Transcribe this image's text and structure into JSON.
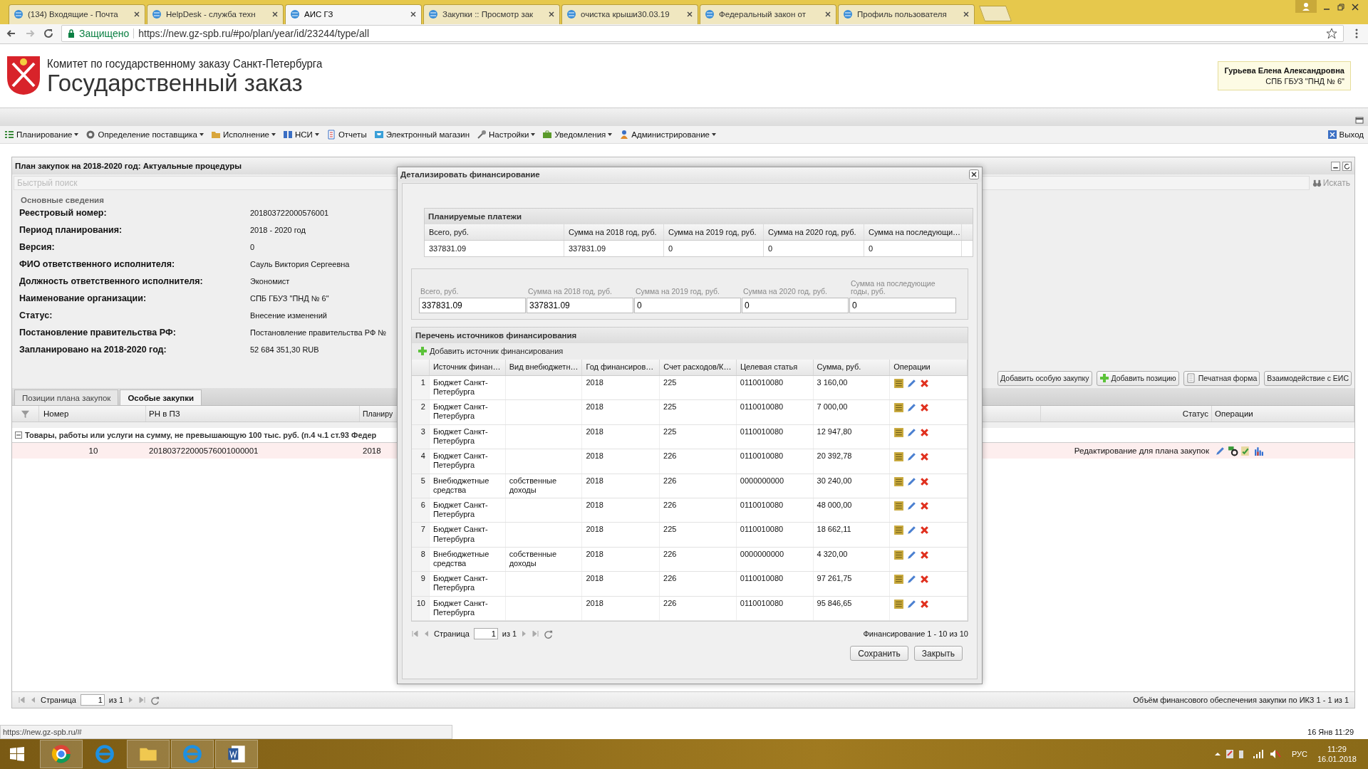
{
  "browser": {
    "tabs": [
      {
        "title": "(134) Входящие - Почта",
        "selected": false
      },
      {
        "title": "HelpDesk - служба техн",
        "selected": false
      },
      {
        "title": "АИС ГЗ",
        "selected": true
      },
      {
        "title": "Закупки :: Просмотр зак",
        "selected": false
      },
      {
        "title": "очистка крыши30.03.19",
        "selected": false
      },
      {
        "title": "Федеральный закон от",
        "selected": false
      },
      {
        "title": "Профиль пользователя",
        "selected": false
      }
    ],
    "secure_label": "Защищено",
    "url": "https://new.gz-spb.ru/#po/plan/year/id/23244/type/all"
  },
  "header": {
    "org": "Комитет по государственному заказу Санкт-Петербурга",
    "title": "Государственный заказ",
    "user_name": "Гурьева Елена Александровна",
    "user_org": "СПБ ГБУЗ \"ПНД № 6\""
  },
  "menu": [
    {
      "label": "Планирование",
      "has_dropdown": true
    },
    {
      "label": "Определение поставщика",
      "has_dropdown": true
    },
    {
      "label": "Исполнение",
      "has_dropdown": true
    },
    {
      "label": "НСИ",
      "has_dropdown": true
    },
    {
      "label": "Отчеты",
      "has_dropdown": false
    },
    {
      "label": "Электронный магазин",
      "has_dropdown": false
    },
    {
      "label": "Настройки",
      "has_dropdown": true
    },
    {
      "label": "Уведомления",
      "has_dropdown": true
    },
    {
      "label": "Администрирование",
      "has_dropdown": true
    }
  ],
  "menu_exit": "Выход",
  "panel": {
    "title": "План закупок на 2018-2020 год: Актуальные процедуры",
    "search_placeholder": "Быстрый поиск",
    "search_button": "Искать",
    "section": "Основные сведения",
    "fields": [
      {
        "label": "Реестровый номер:",
        "value": "201803722000576001"
      },
      {
        "label": "Период планирования:",
        "value": "2018 - 2020 год"
      },
      {
        "label": "Версия:",
        "value": "0"
      },
      {
        "label": "ФИО ответственного исполнителя:",
        "value": "Сауль Виктория Сергеевна"
      },
      {
        "label": "Должность ответственного исполнителя:",
        "value": "Экономист"
      },
      {
        "label": "Наименование организации:",
        "value": "СПБ ГБУЗ \"ПНД № 6\""
      },
      {
        "label": "Статус:",
        "value": "Внесение изменений"
      },
      {
        "label": "Постановление правительства РФ:",
        "value": "Постановление правительства РФ №"
      },
      {
        "label": "Запланировано на 2018-2020 год:",
        "value": "52 684 351,30 RUB"
      }
    ],
    "buttons": [
      "Добавить особую закупку",
      "Добавить позицию",
      "Печатная форма",
      "Взаимодействие с ЕИС"
    ],
    "tabs": [
      {
        "label": "Позиции плана закупок",
        "selected": false
      },
      {
        "label": "Особые закупки",
        "selected": true
      }
    ],
    "columns": [
      "Номер",
      "РН в ПЗ",
      "Планиру",
      "Статус",
      "Операции"
    ],
    "group": "Товары, работы или услуги на сумму, не превышающую 100 тыс. руб. (п.4 ч.1 ст.93 Федер",
    "rows": [
      {
        "number": "10",
        "rn": "201803722000576001000001",
        "year": "2018",
        "status": "Редактирование для плана закупок",
        "selected": true
      }
    ],
    "paging": {
      "label": "Страница",
      "page": "1",
      "of": "из 1",
      "summary": "Объём финансового обеспечения закупки по ИКЗ 1 - 1 из 1"
    }
  },
  "dialog": {
    "title": "Детализировать финансирование",
    "planned": {
      "title": "Планируемые платежи",
      "columns": [
        "Всего, руб.",
        "Сумма на 2018 год, руб.",
        "Сумма на 2019 год, руб.",
        "Сумма на 2020 год, руб.",
        "Сумма на последующи…"
      ],
      "row": [
        "337831.09",
        "337831.09",
        "0",
        "0",
        "0"
      ]
    },
    "fields": [
      {
        "label": "Всего, руб.",
        "value": "337831.09"
      },
      {
        "label": "Сумма на 2018 год, руб.",
        "value": "337831.09"
      },
      {
        "label": "Сумма на 2019 год, руб.",
        "value": "0"
      },
      {
        "label": "Сумма на 2020 год, руб.",
        "value": "0"
      },
      {
        "label": "Сумма на последующие годы, руб.",
        "value": "0"
      }
    ],
    "sources": {
      "title": "Перечень источников финансирования",
      "add_button": "Добавить источник финансирования",
      "columns": [
        "Источник финан…",
        "Вид внебюджетн…",
        "Год финансиров…",
        "Счет расходов/К…",
        "Целевая статья",
        "Сумма, руб.",
        "Операции"
      ],
      "rows": [
        {
          "n": "1",
          "source": "Бюджет Санкт-Петербурга",
          "kind": "",
          "year": "2018",
          "account": "225",
          "target": "0110010080",
          "sum": "3 160,00"
        },
        {
          "n": "2",
          "source": "Бюджет Санкт-Петербурга",
          "kind": "",
          "year": "2018",
          "account": "225",
          "target": "0110010080",
          "sum": "7 000,00"
        },
        {
          "n": "3",
          "source": "Бюджет Санкт-Петербурга",
          "kind": "",
          "year": "2018",
          "account": "225",
          "target": "0110010080",
          "sum": "12 947,80"
        },
        {
          "n": "4",
          "source": "Бюджет Санкт-Петербурга",
          "kind": "",
          "year": "2018",
          "account": "226",
          "target": "0110010080",
          "sum": "20 392,78"
        },
        {
          "n": "5",
          "source": "Внебюджетные средства",
          "kind": "собственные доходы",
          "year": "2018",
          "account": "226",
          "target": "0000000000",
          "sum": "30 240,00"
        },
        {
          "n": "6",
          "source": "Бюджет Санкт-Петербурга",
          "kind": "",
          "year": "2018",
          "account": "226",
          "target": "0110010080",
          "sum": "48 000,00"
        },
        {
          "n": "7",
          "source": "Бюджет Санкт-Петербурга",
          "kind": "",
          "year": "2018",
          "account": "225",
          "target": "0110010080",
          "sum": "18 662,11"
        },
        {
          "n": "8",
          "source": "Внебюджетные средства",
          "kind": "собственные доходы",
          "year": "2018",
          "account": "226",
          "target": "0000000000",
          "sum": "4 320,00"
        },
        {
          "n": "9",
          "source": "Бюджет Санкт-Петербурга",
          "kind": "",
          "year": "2018",
          "account": "226",
          "target": "0110010080",
          "sum": "97 261,75"
        },
        {
          "n": "10",
          "source": "Бюджет Санкт-Петербурга",
          "kind": "",
          "year": "2018",
          "account": "226",
          "target": "0110010080",
          "sum": "95 846,65"
        }
      ]
    },
    "paging": {
      "label": "Страница",
      "page": "1",
      "of": "из 1",
      "summary": "Финансирование 1 - 10 из 10"
    },
    "buttons": [
      "Сохранить",
      "Закрыть"
    ]
  },
  "status_url": "https://new.gz-spb.ru/#",
  "datetime": "16 Янв 11:29",
  "taskbar": {
    "lang": "РУС",
    "time": "11:29",
    "date": "16.01.2018"
  }
}
